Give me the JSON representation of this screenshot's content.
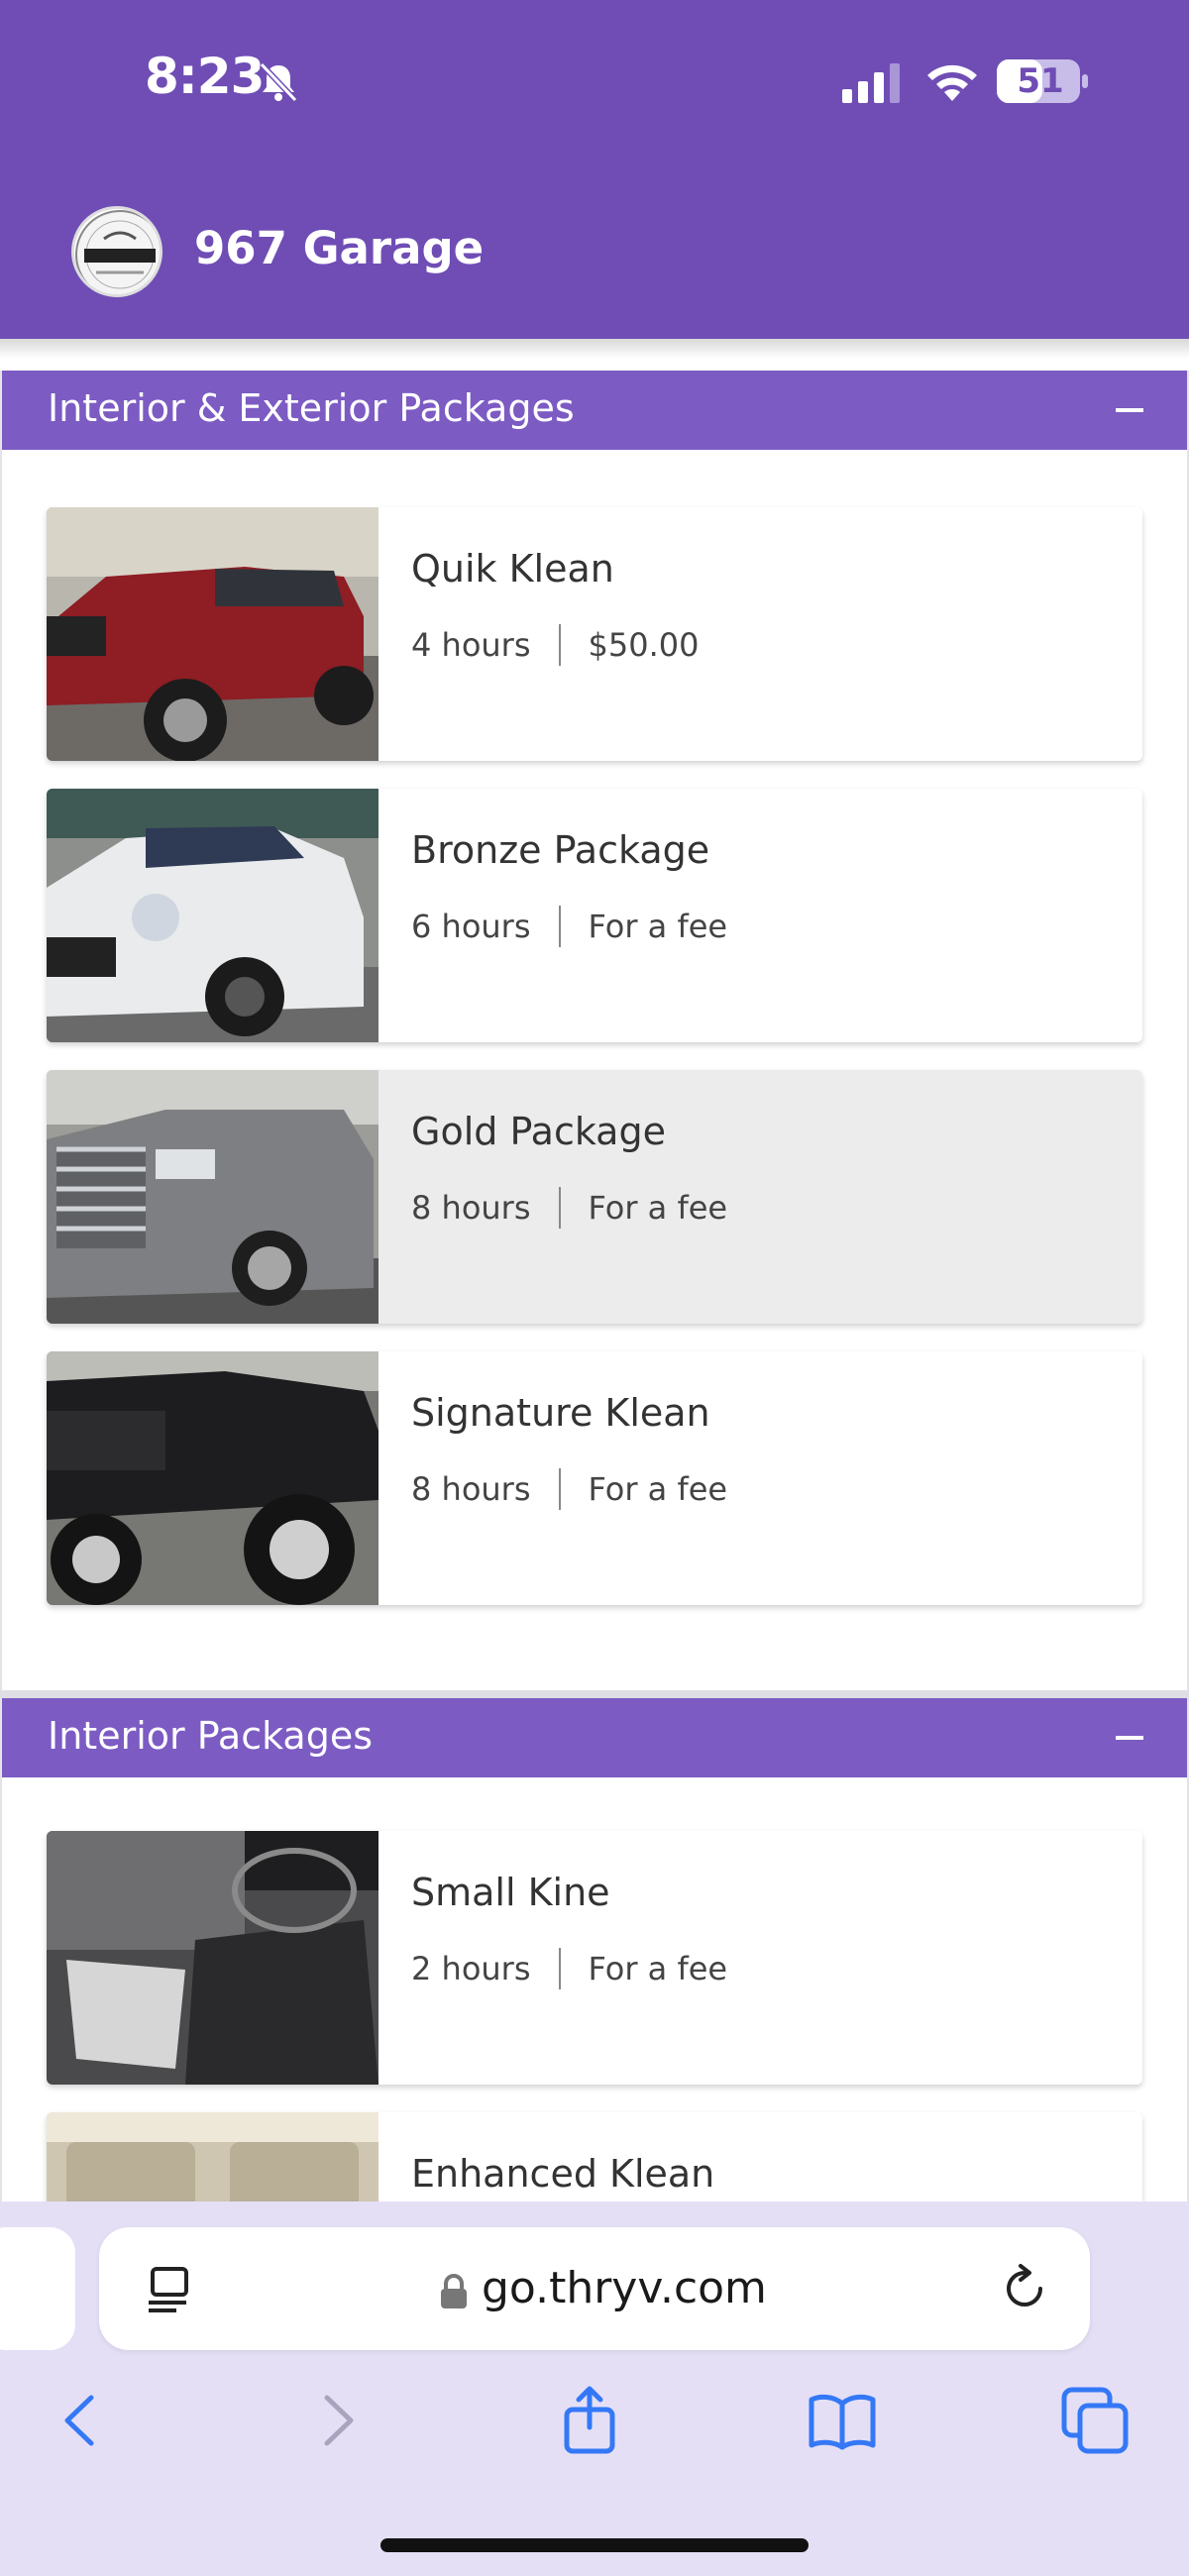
{
  "status_bar": {
    "time": "8:23",
    "battery": "51"
  },
  "header": {
    "brand": "967 Garage",
    "logo_text": "967 Garage"
  },
  "sections": [
    {
      "title": "Interior & Exterior Packages",
      "items": [
        {
          "title": "Quik Klean",
          "duration": "4 hours",
          "price": "$50.00",
          "image": "red-pickup-truck"
        },
        {
          "title": "Bronze Package",
          "duration": "6 hours",
          "price": "For a fee",
          "image": "white-mini-cooper"
        },
        {
          "title": "Gold Package",
          "duration": "8 hours",
          "price": "For a fee",
          "image": "silver-suv"
        },
        {
          "title": "Signature Klean",
          "duration": "8 hours",
          "price": "For a fee",
          "image": "black-lifted-truck"
        }
      ]
    },
    {
      "title": "Interior Packages",
      "items": [
        {
          "title": "Small Kine",
          "duration": "2 hours",
          "price": "For a fee",
          "image": "car-interior-seats"
        },
        {
          "title": "Enhanced Klean",
          "image": "car-interior-rear"
        }
      ]
    }
  ],
  "browser": {
    "url": "go.thryv.com"
  },
  "colors": {
    "header_bg": "#6f4db5",
    "section_header_bg": "#7c5bc3",
    "browser_bg": "#e5dff6",
    "link_blue": "#3478f6"
  },
  "icons": [
    "bell-slash-icon",
    "signal-icon",
    "wifi-icon",
    "battery-icon",
    "collapse-icon",
    "lock-icon",
    "reader-icon",
    "reload-icon",
    "back-icon",
    "forward-icon",
    "share-icon",
    "bookmarks-icon",
    "tabs-icon"
  ]
}
